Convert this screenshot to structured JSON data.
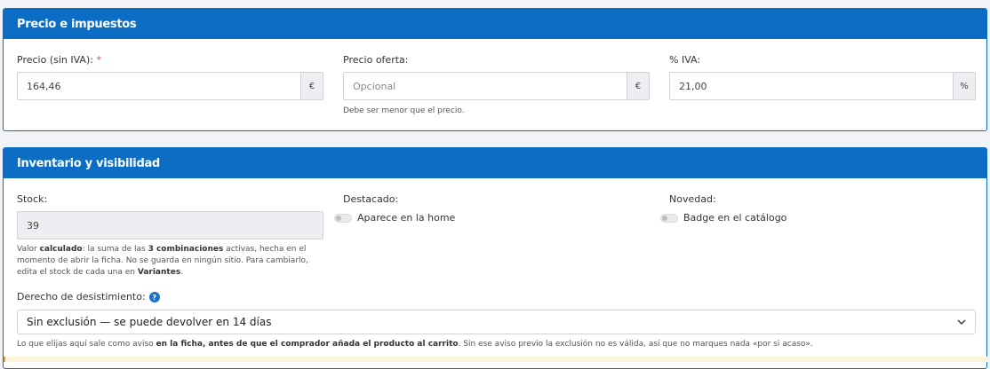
{
  "precio": {
    "title": "Precio e impuestos",
    "precio_label": "Precio (sin IVA):",
    "precio_required": "*",
    "precio_value": "164,46",
    "precio_addon": "€",
    "oferta_label": "Precio oferta:",
    "oferta_placeholder": "Opcional",
    "oferta_addon": "€",
    "oferta_help": "Debe ser menor que el precio.",
    "iva_label": "% IVA:",
    "iva_value": "21,00",
    "iva_addon": "%"
  },
  "inventario": {
    "title": "Inventario y visibilidad",
    "stock_label": "Stock:",
    "stock_value": "39",
    "stock_help": {
      "p1": "Valor ",
      "b1": "calculado",
      "p2": ": la suma de las ",
      "b2": "3 combinaciones",
      "p3": " activas, hecha en el momento de abrir la ficha. No se guarda en ningún sitio. Para cambiarlo, edita el stock de cada una en ",
      "b3": "Variantes",
      "p4": "."
    },
    "destacado_label": "Destacado:",
    "destacado_toggle": "Aparece en la home",
    "novedad_label": "Novedad:",
    "novedad_toggle": "Badge en el catálogo",
    "desistimiento_label": "Derecho de desistimiento:",
    "desistimiento_help_icon": "?",
    "desistimiento_value": "Sin exclusión — se puede devolver en 14 días",
    "desistimiento_note": {
      "p1": "Lo que elijas aquí sale como aviso ",
      "b1": "en la ficha, antes de que el comprador añada el producto al carrito",
      "p2": ". Sin ese aviso previo la exclusión no es válida, así que no marques nada «por si acaso»."
    }
  },
  "icons": {
    "chevron": "chevron-down-icon",
    "help": "question-circle-icon"
  },
  "colors": {
    "header": "#0b6dc4",
    "required": "#d9534f"
  }
}
